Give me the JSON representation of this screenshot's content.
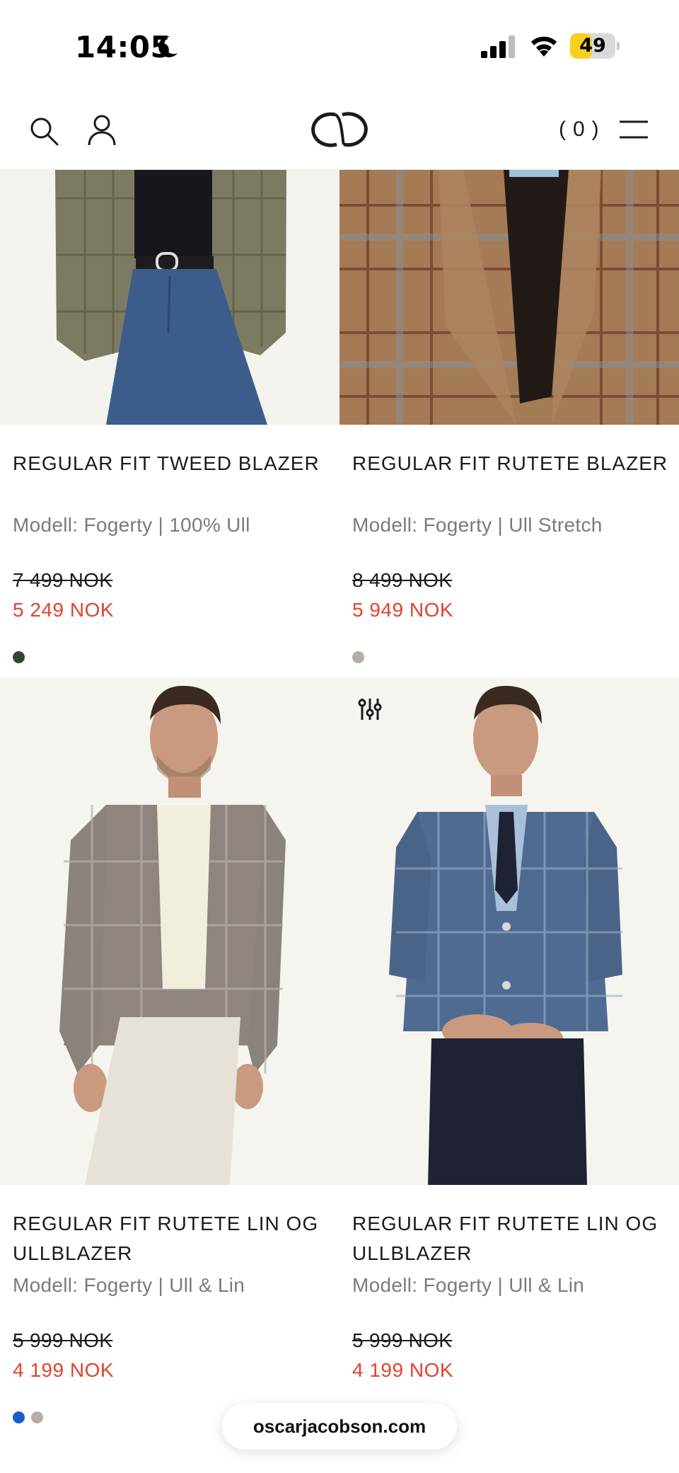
{
  "status_bar": {
    "time": "14:05",
    "battery": "49"
  },
  "header": {
    "cart_label": "(0)"
  },
  "products": [
    {
      "title": "REGULAR FIT TWEED BLAZER",
      "subtitle": "Modell: Fogerty | 100% Ull",
      "old_price": "7 499 NOK",
      "price": "5 249 NOK",
      "colors": [
        "#2e4a2c"
      ]
    },
    {
      "title": "REGULAR FIT RUTETE BLAZER",
      "subtitle": "Modell: Fogerty | Ull Stretch",
      "old_price": "8 499 NOK",
      "price": "5 949 NOK",
      "colors": [
        "#b6ada4"
      ]
    },
    {
      "title": "REGULAR FIT RUTETE LIN OG ULLBLAZER",
      "subtitle": "Modell: Fogerty | Ull & Lin",
      "old_price": "5 999 NOK",
      "price": "4 199 NOK",
      "colors": [
        "#1a5fce",
        "#b6ada4"
      ]
    },
    {
      "title": "REGULAR FIT RUTETE LIN OG ULLBLAZER",
      "subtitle": "Modell: Fogerty | Ull & Lin",
      "old_price": "5 999 NOK",
      "price": "4 199 NOK",
      "colors": [
        "#8fd2f2",
        "#e8b7a8"
      ]
    }
  ],
  "browser": {
    "url": "oscarjacobson.com"
  }
}
